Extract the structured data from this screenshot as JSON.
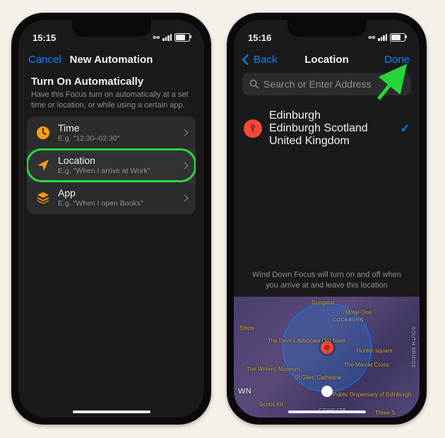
{
  "left_phone": {
    "status": {
      "time": "15:15"
    },
    "nav": {
      "cancel": "Cancel",
      "title": "New Automation"
    },
    "section": {
      "title": "Turn On Automatically",
      "subtitle": "Have this Focus turn on automatically at a set time or location, or while using a certain app."
    },
    "rows": {
      "time": {
        "label": "Time",
        "sub": "E.g. \"12:30–02:30\"",
        "icon": "clock-icon"
      },
      "location": {
        "label": "Location",
        "sub": "E.g. \"When I arrive at Work\"",
        "icon": "nav-arrow-icon"
      },
      "app": {
        "label": "App",
        "sub": "E.g. \"When I open Books\"",
        "icon": "stack-icon"
      }
    }
  },
  "right_phone": {
    "status": {
      "time": "15:16"
    },
    "nav": {
      "back": "Back",
      "title": "Location",
      "done": "Done"
    },
    "search_placeholder": "Search or Enter Address",
    "result": {
      "title": "Edinburgh",
      "subtitle": "Edinburgh Scotland United Kingdom"
    },
    "hint": "Wind Down Focus will turn on and off when you arrive at and leave this location",
    "map_pois": {
      "devils": "The Devil's Advocate Old Town",
      "writers": "The Writers' Museum",
      "stgiles": "St Giles' Cathedral",
      "hunter": "Hunter square",
      "mercat": "The Mercat Cross",
      "motel": "Motel One",
      "dungeon": "Dungeon",
      "scotts": "Scotts Kit",
      "dispensary": "Public Dispensary of Edinburgh",
      "steps": "Steps",
      "cockburn": "COCKBURN",
      "cowgate": "COWGATE",
      "wn": "WN",
      "southbridge": "SOUTH BRIDGE",
      "three": "Three S"
    }
  }
}
